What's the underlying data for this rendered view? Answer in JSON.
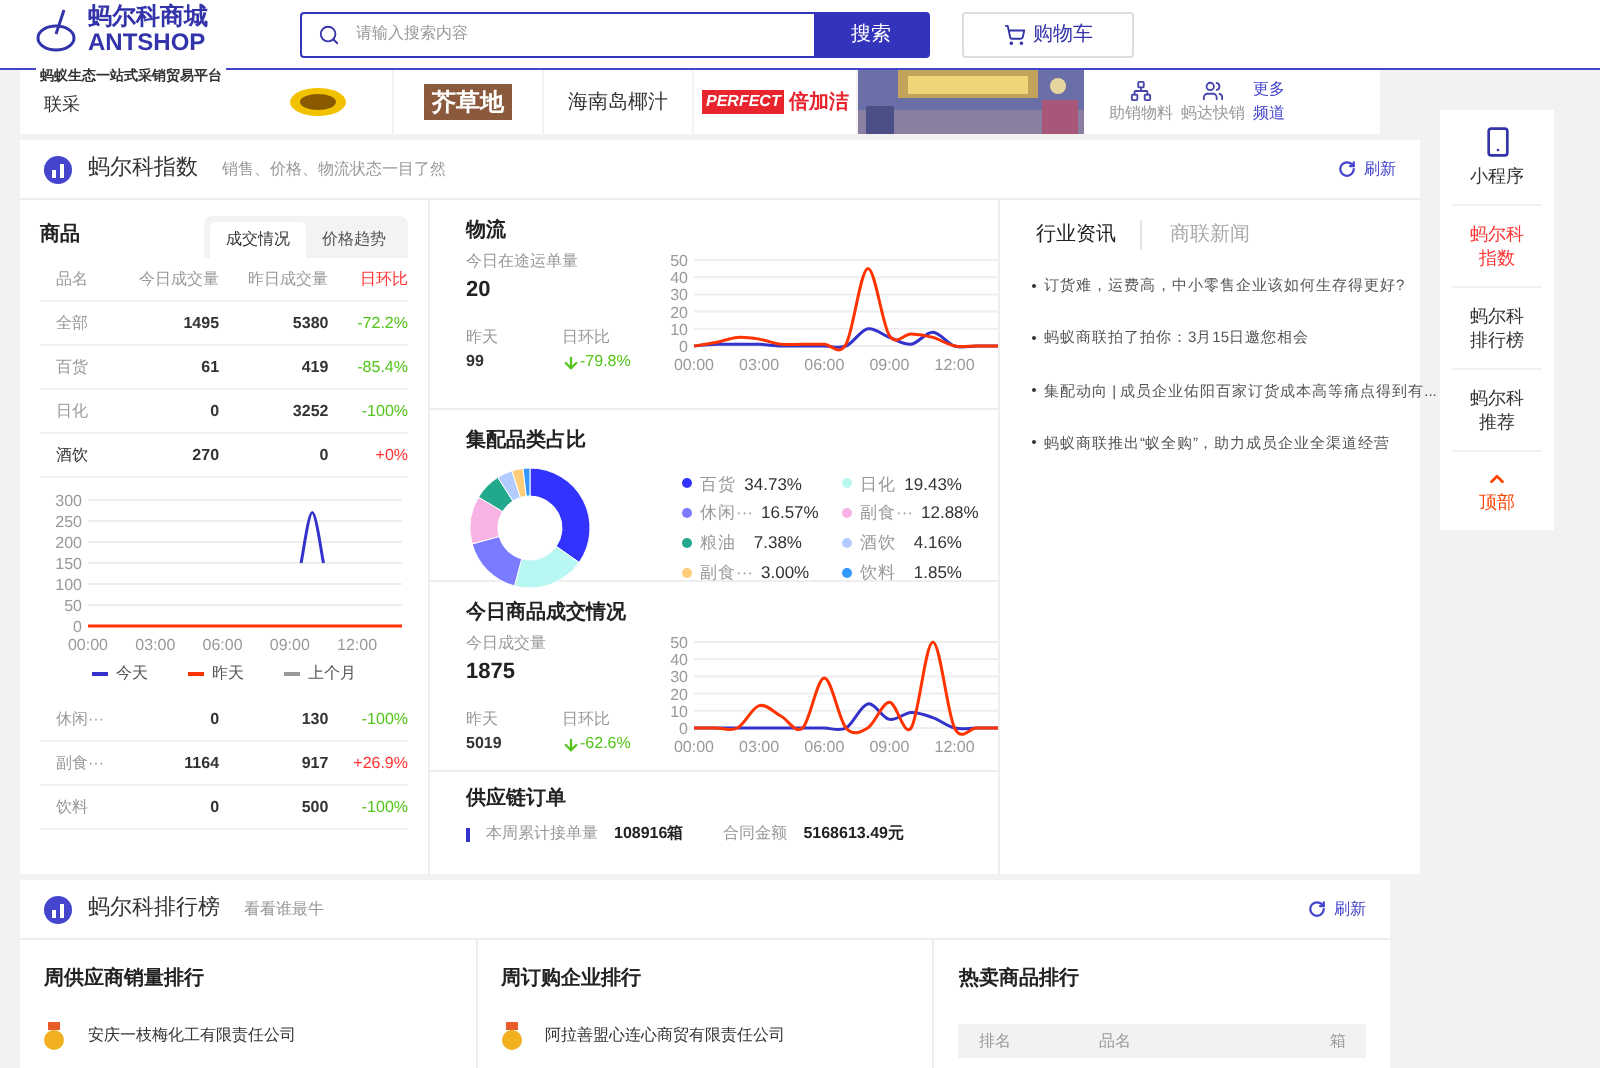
{
  "header": {
    "logo_name": "蚂尔科商城",
    "logo_en": "ANTSHOP",
    "tagline": "蚂蚁生态一站式采销贸易平台",
    "search": {
      "placeholder": "请输入搜索内容",
      "button": "搜索"
    },
    "cart": "购物车"
  },
  "strip": {
    "label": "联采",
    "brands": [
      {
        "kind": "badge"
      },
      {
        "kind": "boxed",
        "text": "芥草地"
      },
      {
        "kind": "plain",
        "text": "海南岛椰汁"
      },
      {
        "kind": "perfect",
        "text": "PERFECT",
        "text2": "倍加洁"
      }
    ],
    "shortcuts": [
      {
        "kind": "nodes",
        "label": "助销物料"
      },
      {
        "kind": "people",
        "label": "蚂达快销"
      },
      {
        "kind": "more",
        "label": "更多频道"
      }
    ]
  },
  "index_panel": {
    "title": "蚂尔科指数",
    "subtitle": "销售、价格、物流状态一目了然",
    "refresh": "刷新",
    "goods": {
      "title": "商品",
      "tabs": [
        {
          "label": "成交情况",
          "selected": true
        },
        {
          "label": "价格趋势",
          "selected": false
        }
      ],
      "columns": [
        "品名",
        "今日成交量",
        "昨日成交量",
        "日环比"
      ],
      "rows_top": [
        {
          "name": "全部",
          "today": "1495",
          "yesterday": "5380",
          "change": "-72.2%",
          "rising": false,
          "selected": false
        },
        {
          "name": "百货",
          "today": "61",
          "yesterday": "419",
          "change": "-85.4%",
          "rising": false,
          "selected": false
        },
        {
          "name": "日化",
          "today": "0",
          "yesterday": "3252",
          "change": "-100%",
          "rising": false,
          "selected": false
        },
        {
          "name": "酒饮",
          "today": "270",
          "yesterday": "0",
          "change": "+0%",
          "rising": true,
          "selected": true
        }
      ],
      "chart_data": {
        "type": "line",
        "x": [
          0,
          1,
          2,
          3,
          4,
          5,
          6,
          7,
          8,
          9,
          9.5,
          10,
          10.5,
          11,
          12,
          13,
          14
        ],
        "xlim": [
          0,
          14
        ],
        "ylim": [
          0,
          300
        ],
        "yticks": [
          0,
          50,
          100,
          150,
          200,
          250,
          300
        ],
        "xticks": [
          {
            "value": 0,
            "label": "00:00"
          },
          {
            "value": 3,
            "label": "03:00"
          },
          {
            "value": 6,
            "label": "06:00"
          },
          {
            "value": 9,
            "label": "09:00"
          },
          {
            "value": 12,
            "label": "12:00"
          }
        ],
        "grid": true,
        "series": [
          {
            "name": "今天",
            "color": "#3333cc",
            "values": [
              null,
              null,
              null,
              null,
              null,
              null,
              null,
              null,
              null,
              null,
              150,
              270,
              150,
              null,
              null,
              null,
              null
            ]
          },
          {
            "name": "昨天",
            "color": "#ff3300",
            "values": [
              0,
              0,
              0,
              0,
              0,
              0,
              0,
              0,
              0,
              0,
              0,
              0,
              0,
              0,
              0,
              0,
              0
            ]
          },
          {
            "name": "上个月",
            "color": "#999999",
            "values": [
              null,
              null,
              null,
              null,
              null,
              null,
              null,
              null,
              null,
              null,
              null,
              null,
              null,
              null,
              null,
              null,
              null
            ]
          }
        ]
      },
      "rows_bottom": [
        {
          "name": "休闲···",
          "today": "0",
          "yesterday": "130",
          "change": "-100%",
          "rising": false,
          "selected": false
        },
        {
          "name": "副食···",
          "today": "1164",
          "yesterday": "917",
          "change": "+26.9%",
          "rising": true,
          "selected": false
        },
        {
          "name": "饮料",
          "today": "0",
          "yesterday": "500",
          "change": "-100%",
          "rising": false,
          "selected": false
        }
      ]
    },
    "logistics": {
      "title": "物流",
      "metric_label": "今日在途运单量",
      "metric": "20",
      "yesterday_label": "昨天",
      "yesterday": "99",
      "change_label": "日环比",
      "change": "-79.8%",
      "rising": false,
      "chart_data": {
        "type": "line",
        "x": [
          0,
          1,
          2,
          3,
          4,
          5,
          6,
          7,
          8,
          9,
          10,
          11,
          12,
          13,
          14
        ],
        "xlim": [
          0,
          14
        ],
        "ylim": [
          0,
          50
        ],
        "yticks": [
          0,
          10,
          20,
          30,
          40,
          50
        ],
        "xticks": [
          {
            "value": 0,
            "label": "00:00"
          },
          {
            "value": 3,
            "label": "03:00"
          },
          {
            "value": 6,
            "label": "06:00"
          },
          {
            "value": 9,
            "label": "09:00"
          },
          {
            "value": 12,
            "label": "12:00"
          }
        ],
        "grid": true,
        "series": [
          {
            "color": "#3333cc",
            "values": [
              0,
              1,
              1,
              1,
              0,
              0,
              0,
              0,
              10,
              5,
              1,
              8,
              0,
              0,
              0
            ]
          },
          {
            "color": "#ff3300",
            "values": [
              0,
              2,
              5,
              4,
              1,
              1,
              1,
              1,
              45,
              6,
              7,
              5,
              0,
              0,
              0
            ]
          }
        ]
      }
    },
    "category_share": {
      "title": "集配品类占比",
      "chart_data": {
        "type": "donut",
        "categories": [
          "百货",
          "日化",
          "休闲···",
          "副食···",
          "粮油",
          "酒饮",
          "副食···",
          "饮料"
        ],
        "values": [
          34.73,
          19.43,
          16.57,
          12.88,
          7.38,
          4.16,
          3.0,
          1.85
        ],
        "value_labels": [
          "34.73%",
          "19.43%",
          "16.57%",
          "12.88%",
          "7.38%",
          "4.16%",
          "3.00%",
          "1.85%"
        ],
        "colors": [
          "#3333ff",
          "#b8f7f2",
          "#7b7bff",
          "#f7b3e3",
          "#22a88a",
          "#b3ccff",
          "#ffcc77",
          "#3399ff"
        ],
        "legend": "right"
      }
    },
    "today_deals": {
      "title": "今日商品成交情况",
      "metric_label": "今日成交量",
      "metric": "1875",
      "yesterday_label": "昨天",
      "yesterday": "5019",
      "change_label": "日环比",
      "change": "-62.6%",
      "rising": false,
      "chart_data": {
        "type": "line",
        "x": [
          0,
          1,
          2,
          3,
          4,
          5,
          6,
          7,
          8,
          9,
          10,
          11,
          12,
          13,
          14
        ],
        "xlim": [
          0,
          14
        ],
        "ylim": [
          0,
          50
        ],
        "yticks": [
          0,
          10,
          20,
          30,
          40,
          50
        ],
        "xticks": [
          {
            "value": 0,
            "label": "00:00"
          },
          {
            "value": 3,
            "label": "03:00"
          },
          {
            "value": 6,
            "label": "06:00"
          },
          {
            "value": 9,
            "label": "09:00"
          },
          {
            "value": 12,
            "label": "12:00"
          }
        ],
        "grid": true,
        "series": [
          {
            "color": "#3333cc",
            "values": [
              0,
              0,
              0,
              0,
              0,
              0,
              0,
              0,
              14,
              5,
              9,
              6,
              0,
              0,
              0
            ]
          },
          {
            "color": "#ff3300",
            "values": [
              0,
              0,
              0,
              13,
              7,
              0,
              29,
              0,
              0,
              15,
              0,
              50,
              0,
              0,
              0
            ]
          }
        ]
      }
    },
    "supply_orders": {
      "title": "供应链订单",
      "items": [
        {
          "label": "本周累计接单量",
          "value": "108916箱"
        },
        {
          "label": "合同金额",
          "value": "5168613.49元"
        }
      ]
    },
    "news": {
      "tabs": [
        {
          "label": "行业资讯",
          "selected": true
        },
        {
          "label": "商联新闻",
          "selected": false
        }
      ],
      "items": [
        "订货难，运费高，中小零售企业该如何生存得更好?",
        "蚂蚁商联拍了拍你：3月15日邀您相会",
        "集配动向 | 成员企业佑阳百家订货成本高等痛点得到有...",
        "蚂蚁商联推出“蚁全购”，助力成员企业全渠道经营"
      ]
    }
  },
  "ranking_panel": {
    "title": "蚂尔科排行榜",
    "subtitle": "看看谁最牛",
    "refresh": "刷新",
    "columns": [
      {
        "kind": "list",
        "title": "周供应商销量排行",
        "rows": [
          "安庆一枝梅化工有限责任公司"
        ]
      },
      {
        "kind": "list",
        "title": "周订购企业排行",
        "rows": [
          "阿拉善盟心连心商贸有限责任公司"
        ]
      },
      {
        "kind": "table",
        "title": "热卖商品排行",
        "headers": [
          "排名",
          "品名",
          "箱"
        ]
      }
    ]
  },
  "sidebar": [
    {
      "kind": "phone",
      "label": "小程序",
      "selected": false
    },
    {
      "kind": "text",
      "label": "蚂尔科指数",
      "selected": true
    },
    {
      "kind": "text",
      "label": "蚂尔科排行榜",
      "selected": false
    },
    {
      "kind": "text",
      "label": "蚂尔科推荐",
      "selected": false
    },
    {
      "kind": "top",
      "label": "顶部",
      "selected": false
    }
  ]
}
